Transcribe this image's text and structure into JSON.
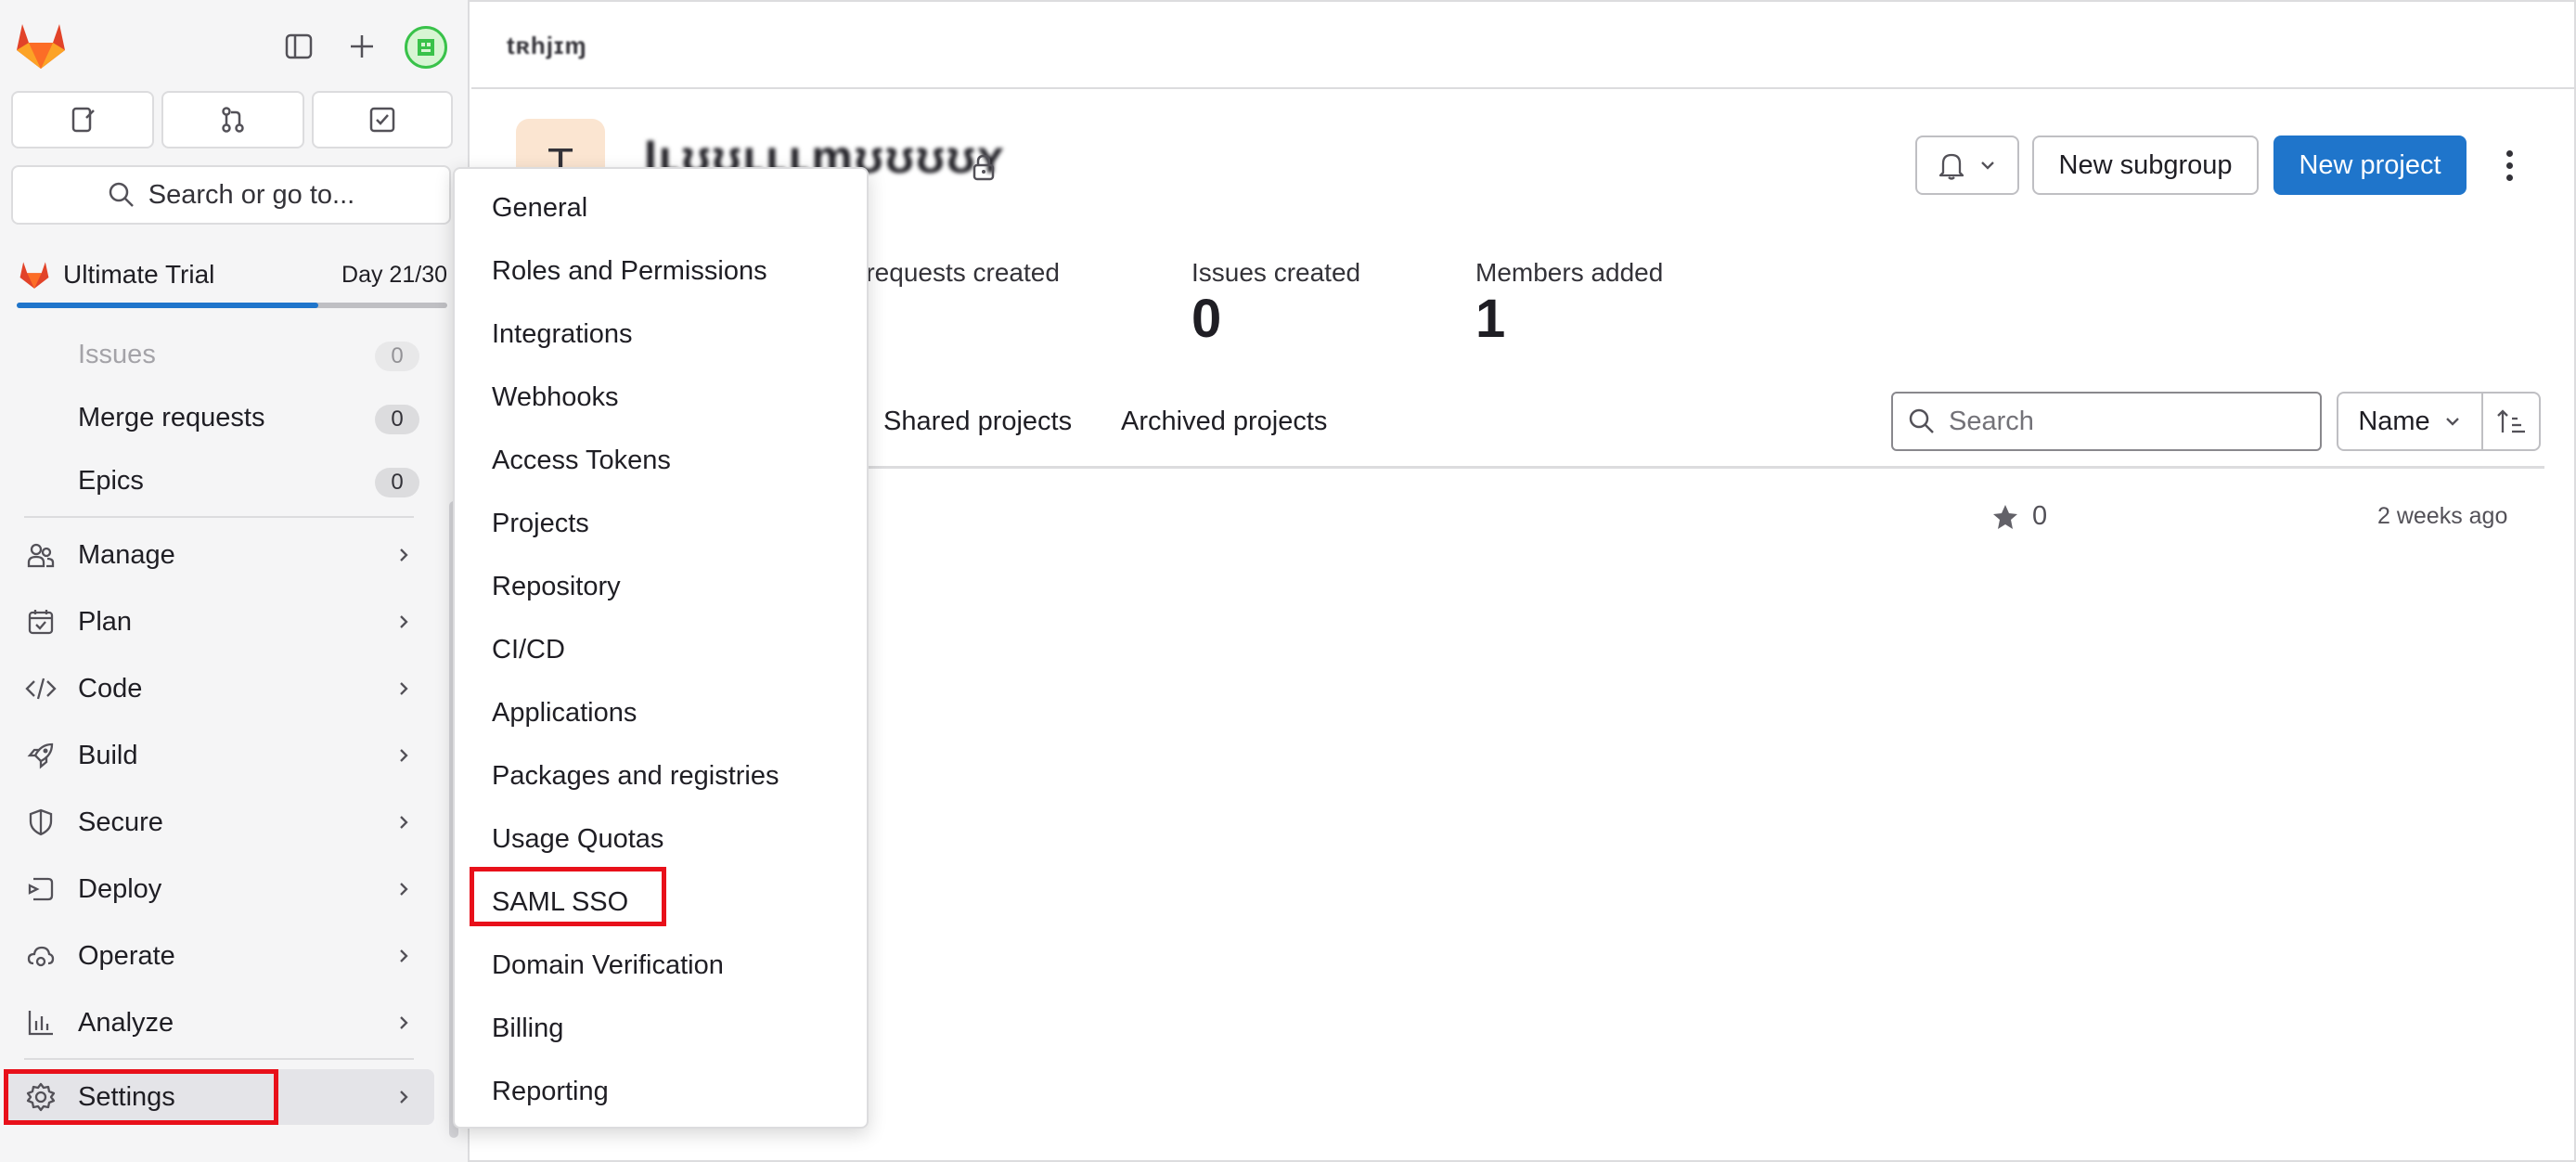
{
  "breadcrumb": "tʀhjɪɱ",
  "group": {
    "avatar_letter": "T",
    "name": "Iʟʊʊʟʟʟɱʊʊʊʊʏ"
  },
  "sidebar": {
    "search_label": "Search or go to...",
    "trial": {
      "label": "Ultimate Trial",
      "day": "Day 21/30",
      "progress": 0.7
    },
    "sub_items": [
      {
        "label": "Issues",
        "count": "0"
      },
      {
        "label": "Merge requests",
        "count": "0"
      },
      {
        "label": "Epics",
        "count": "0"
      }
    ],
    "nav": [
      {
        "label": "Manage",
        "icon": "users-icon"
      },
      {
        "label": "Plan",
        "icon": "calendar-icon"
      },
      {
        "label": "Code",
        "icon": "code-icon"
      },
      {
        "label": "Build",
        "icon": "rocket-icon"
      },
      {
        "label": "Secure",
        "icon": "shield-icon"
      },
      {
        "label": "Deploy",
        "icon": "deploy-icon"
      },
      {
        "label": "Operate",
        "icon": "cloud-gear-icon"
      },
      {
        "label": "Analyze",
        "icon": "chart-icon"
      },
      {
        "label": "Settings",
        "icon": "gear-icon"
      }
    ]
  },
  "header": {
    "new_subgroup": "New subgroup",
    "new_project": "New project"
  },
  "stats": [
    {
      "label": "e requests created",
      "value": ""
    },
    {
      "label": "Issues created",
      "value": "0"
    },
    {
      "label": "Members added",
      "value": "1"
    }
  ],
  "tabs": [
    "Shared projects",
    "Archived projects"
  ],
  "filter": {
    "search_placeholder": "Search",
    "sort_label": "Name"
  },
  "project_row": {
    "stars": "0",
    "updated": "2 weeks ago"
  },
  "settings_menu": [
    "General",
    "Roles and Permissions",
    "Integrations",
    "Webhooks",
    "Access Tokens",
    "Projects",
    "Repository",
    "CI/CD",
    "Applications",
    "Packages and registries",
    "Usage Quotas",
    "SAML SSO",
    "Domain Verification",
    "Billing",
    "Reporting"
  ],
  "colors": {
    "primary": "#1f75cb",
    "highlight": "#e8101a",
    "sidebar_bg": "#f5f5f6"
  }
}
